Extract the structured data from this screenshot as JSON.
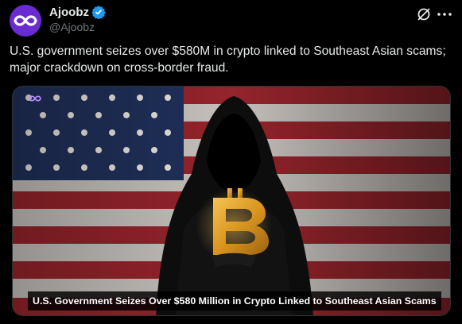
{
  "author": {
    "display_name": "Ajoobz",
    "handle": "@Ajoobz",
    "avatar_icon": "infinity-logo-icon",
    "verified": true
  },
  "actions": {
    "grok_icon": "grok-icon",
    "more_icon": "more-dots-icon"
  },
  "tweet": {
    "text": "U.S. government seizes over $580M in crypto linked to Southeast Asian scams; major crackdown on cross-border fraud."
  },
  "media": {
    "caption": "U.S. Government Seizes Over $580 Million in Crypto Linked to Southeast Asian Scams",
    "watermark_icon": "ajoobz-small-logo-icon",
    "subject_icon": "bitcoin-logo-icon"
  },
  "colors": {
    "brand_purple": "#6a2bd1",
    "verified_blue": "#1d9bf0",
    "bitcoin_gold": "#e8a72a"
  }
}
